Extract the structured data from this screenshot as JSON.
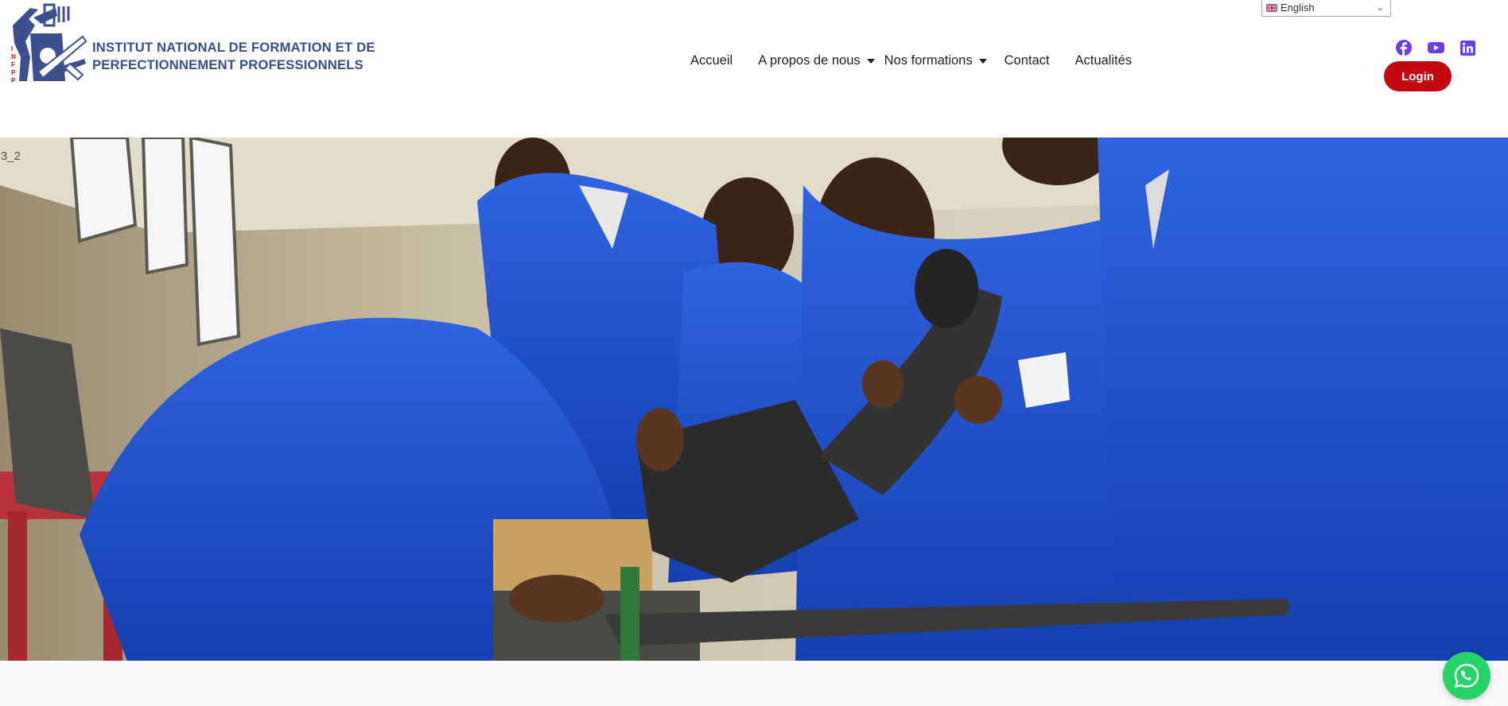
{
  "header": {
    "logo_alt": "INFPP",
    "org_name_line1": "INSTITUT NATIONAL DE FORMATION ET DE",
    "org_name_line2": "PERFECTIONNEMENT PROFESSIONNELS",
    "logo_vertical_letters": "INFPP"
  },
  "nav": {
    "items": [
      {
        "label": "Accueil",
        "has_dropdown": false
      },
      {
        "label": "A propos de nous",
        "has_dropdown": true
      },
      {
        "label": "Nos formations",
        "has_dropdown": true
      },
      {
        "label": "Contact",
        "has_dropdown": false
      },
      {
        "label": "Actualités",
        "has_dropdown": false
      }
    ]
  },
  "language": {
    "selected": "English",
    "flag_icon": "uk-flag-icon"
  },
  "social": [
    {
      "icon": "facebook-icon",
      "color": "#6b3cf0"
    },
    {
      "icon": "youtube-icon",
      "color": "#6b3cf0"
    },
    {
      "icon": "linkedin-icon",
      "color": "#6b3cf0"
    }
  ],
  "login_label": "Login",
  "hero": {
    "caption": "3_2"
  },
  "colors": {
    "brand_blue": "#34508f",
    "login_red": "#c4080f",
    "social_purple": "#6b3cf0",
    "whatsapp_green": "#25d366"
  },
  "whatsapp": {
    "icon": "whatsapp-icon"
  }
}
